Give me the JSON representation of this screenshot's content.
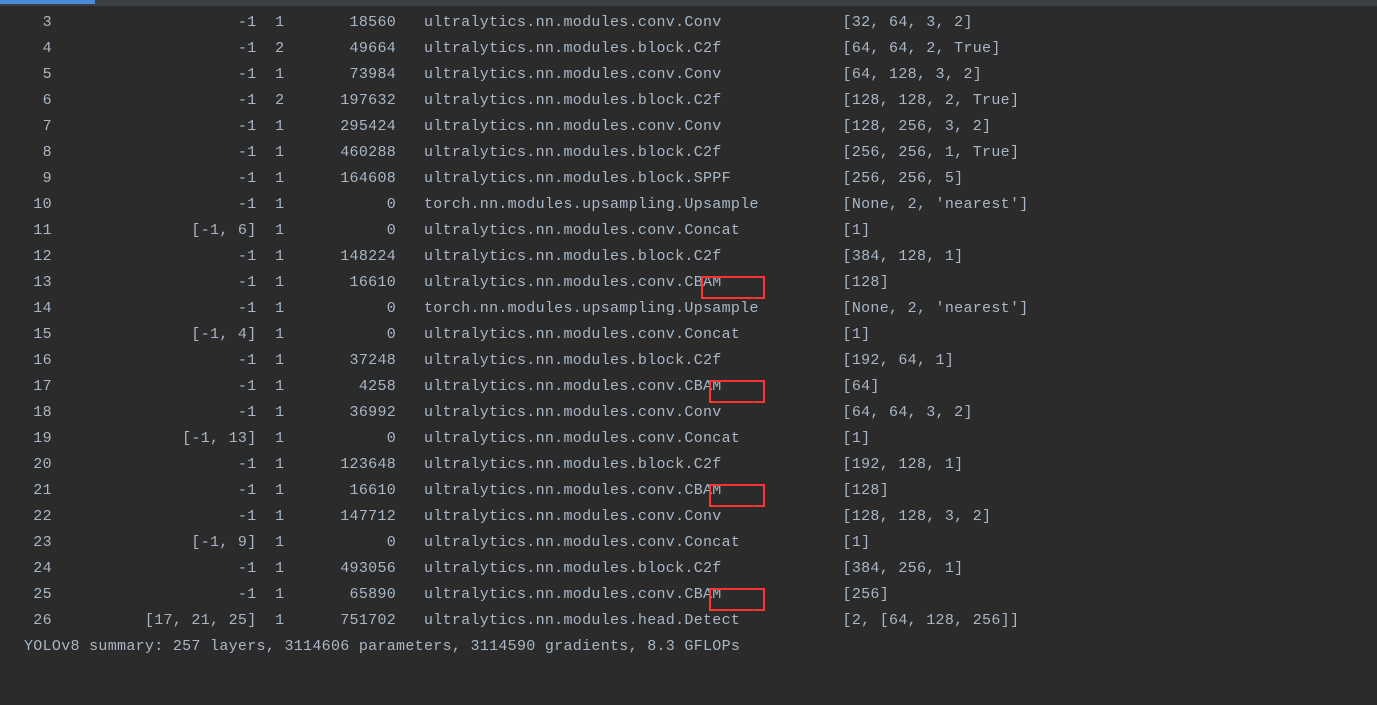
{
  "rows": [
    {
      "idx": "3",
      "from": "-1",
      "n": "1",
      "params": "18560",
      "module": "ultralytics.nn.modules.conv.Conv",
      "args": "[32, 64, 3, 2]"
    },
    {
      "idx": "4",
      "from": "-1",
      "n": "2",
      "params": "49664",
      "module": "ultralytics.nn.modules.block.C2f",
      "args": "[64, 64, 2, True]"
    },
    {
      "idx": "5",
      "from": "-1",
      "n": "1",
      "params": "73984",
      "module": "ultralytics.nn.modules.conv.Conv",
      "args": "[64, 128, 3, 2]"
    },
    {
      "idx": "6",
      "from": "-1",
      "n": "2",
      "params": "197632",
      "module": "ultralytics.nn.modules.block.C2f",
      "args": "[128, 128, 2, True]"
    },
    {
      "idx": "7",
      "from": "-1",
      "n": "1",
      "params": "295424",
      "module": "ultralytics.nn.modules.conv.Conv",
      "args": "[128, 256, 3, 2]"
    },
    {
      "idx": "8",
      "from": "-1",
      "n": "1",
      "params": "460288",
      "module": "ultralytics.nn.modules.block.C2f",
      "args": "[256, 256, 1, True]"
    },
    {
      "idx": "9",
      "from": "-1",
      "n": "1",
      "params": "164608",
      "module": "ultralytics.nn.modules.block.SPPF",
      "args": "[256, 256, 5]"
    },
    {
      "idx": "10",
      "from": "-1",
      "n": "1",
      "params": "0",
      "module": "torch.nn.modules.upsampling.Upsample",
      "args": "[None, 2, 'nearest']"
    },
    {
      "idx": "11",
      "from": "[-1, 6]",
      "n": "1",
      "params": "0",
      "module": "ultralytics.nn.modules.conv.Concat",
      "args": "[1]"
    },
    {
      "idx": "12",
      "from": "-1",
      "n": "1",
      "params": "148224",
      "module": "ultralytics.nn.modules.block.C2f",
      "args": "[384, 128, 1]"
    },
    {
      "idx": "13",
      "from": "-1",
      "n": "1",
      "params": "16610",
      "module": "ultralytics.nn.modules.conv.CBAM",
      "args": "[128]",
      "hl": "h1"
    },
    {
      "idx": "14",
      "from": "-1",
      "n": "1",
      "params": "0",
      "module": "torch.nn.modules.upsampling.Upsample",
      "args": "[None, 2, 'nearest']"
    },
    {
      "idx": "15",
      "from": "[-1, 4]",
      "n": "1",
      "params": "0",
      "module": "ultralytics.nn.modules.conv.Concat",
      "args": "[1]"
    },
    {
      "idx": "16",
      "from": "-1",
      "n": "1",
      "params": "37248",
      "module": "ultralytics.nn.modules.block.C2f",
      "args": "[192, 64, 1]"
    },
    {
      "idx": "17",
      "from": "-1",
      "n": "1",
      "params": "4258",
      "module": "ultralytics.nn.modules.conv.CBAM",
      "args": "[64]",
      "hl": "h2"
    },
    {
      "idx": "18",
      "from": "-1",
      "n": "1",
      "params": "36992",
      "module": "ultralytics.nn.modules.conv.Conv",
      "args": "[64, 64, 3, 2]"
    },
    {
      "idx": "19",
      "from": "[-1, 13]",
      "n": "1",
      "params": "0",
      "module": "ultralytics.nn.modules.conv.Concat",
      "args": "[1]"
    },
    {
      "idx": "20",
      "from": "-1",
      "n": "1",
      "params": "123648",
      "module": "ultralytics.nn.modules.block.C2f",
      "args": "[192, 128, 1]"
    },
    {
      "idx": "21",
      "from": "-1",
      "n": "1",
      "params": "16610",
      "module": "ultralytics.nn.modules.conv.CBAM",
      "args": "[128]",
      "hl": "h3"
    },
    {
      "idx": "22",
      "from": "-1",
      "n": "1",
      "params": "147712",
      "module": "ultralytics.nn.modules.conv.Conv",
      "args": "[128, 128, 3, 2]"
    },
    {
      "idx": "23",
      "from": "[-1, 9]",
      "n": "1",
      "params": "0",
      "module": "ultralytics.nn.modules.conv.Concat",
      "args": "[1]"
    },
    {
      "idx": "24",
      "from": "-1",
      "n": "1",
      "params": "493056",
      "module": "ultralytics.nn.modules.block.C2f",
      "args": "[384, 256, 1]"
    },
    {
      "idx": "25",
      "from": "-1",
      "n": "1",
      "params": "65890",
      "module": "ultralytics.nn.modules.conv.CBAM",
      "args": "[256]",
      "hl": "h4"
    },
    {
      "idx": "26",
      "from": "[17, 21, 25]",
      "n": "1",
      "params": "751702",
      "module": "ultralytics.nn.modules.head.Detect",
      "args": "[2, [64, 128, 256]]"
    }
  ],
  "summary": "YOLOv8 summary: 257 layers, 3114606 parameters, 3114590 gradients, 8.3 GFLOPs",
  "col_widths": {
    "idx": 3,
    "from": 22,
    "n": 3,
    "params": 10,
    "module": 45
  }
}
